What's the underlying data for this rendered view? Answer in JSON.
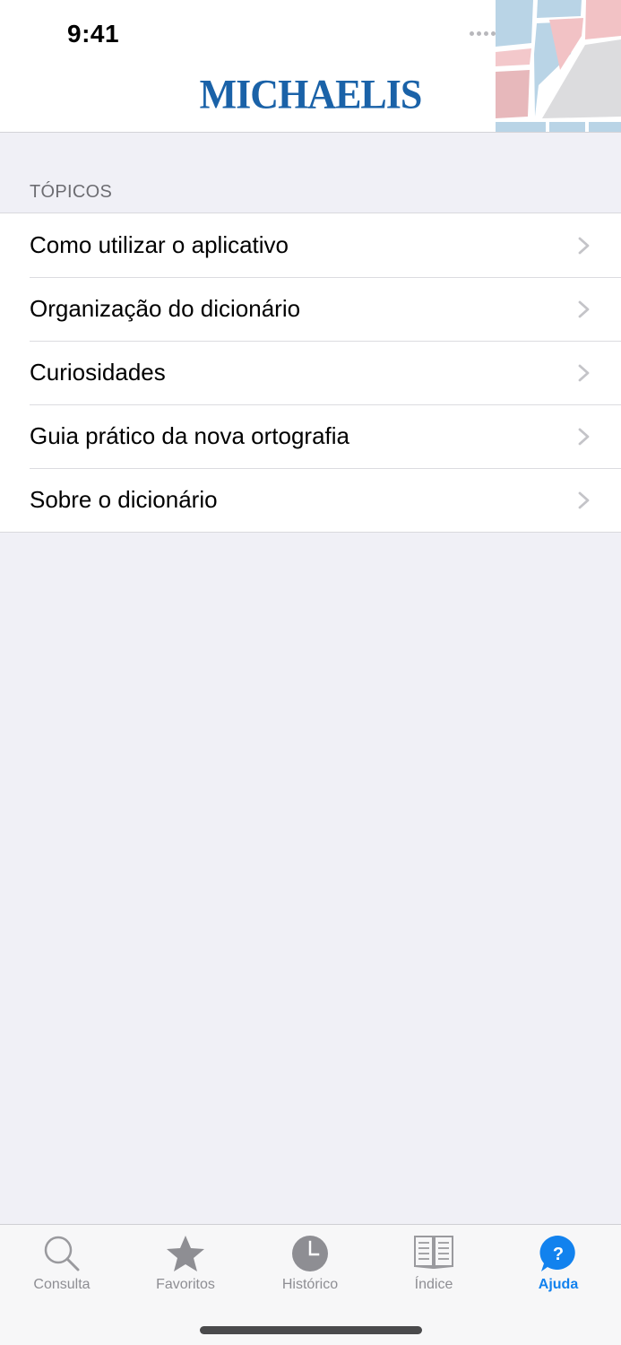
{
  "status_bar": {
    "time": "9:41"
  },
  "header": {
    "logo_text": "MICHAELIS"
  },
  "section": {
    "title": "TÓPICOS"
  },
  "topics": [
    {
      "label": "Como utilizar o aplicativo"
    },
    {
      "label": "Organização do dicionário"
    },
    {
      "label": "Curiosidades"
    },
    {
      "label": "Guia prático da nova ortografia"
    },
    {
      "label": "Sobre o dicionário"
    }
  ],
  "tabbar": {
    "items": [
      {
        "label": "Consulta",
        "icon": "search-icon",
        "active": false
      },
      {
        "label": "Favoritos",
        "icon": "star-icon",
        "active": false
      },
      {
        "label": "Histórico",
        "icon": "clock-icon",
        "active": false
      },
      {
        "label": "Índice",
        "icon": "book-icon",
        "active": false
      },
      {
        "label": "Ajuda",
        "icon": "help-icon",
        "active": true
      }
    ]
  },
  "colors": {
    "accent": "#1282ee",
    "logo": "#1a62a8",
    "background": "#f0f0f6"
  }
}
